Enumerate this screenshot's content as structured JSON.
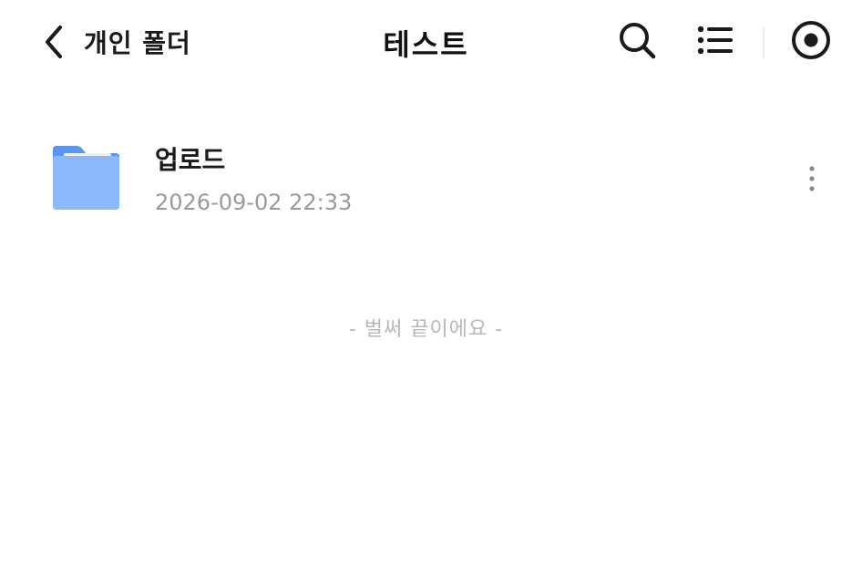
{
  "header": {
    "back_label": "개인 폴더",
    "title": "테스트",
    "icons": {
      "back": "chevron-left-icon",
      "search": "search-icon",
      "list": "list-view-icon",
      "more": "more-circle-icon"
    }
  },
  "files": [
    {
      "name": "업로드",
      "date": "2026-09-02 22:33",
      "icon": "folder-icon"
    }
  ],
  "list_end_message": "- 벌써 끝이에요 -",
  "colors": {
    "folder_light": "#8cb9fb",
    "folder_dark": "#5b95f2",
    "text_primary": "#1a1a1a",
    "text_secondary": "#9a9a9a",
    "text_muted": "#b8b8b8"
  }
}
